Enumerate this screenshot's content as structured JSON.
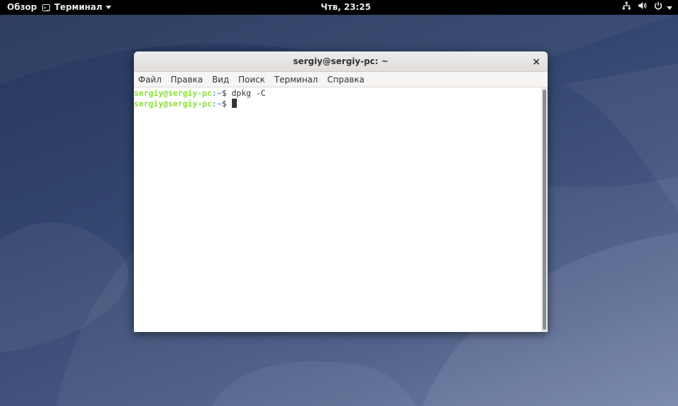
{
  "topbar": {
    "activities_label": "Обзор",
    "app_menu_label": "Терминал",
    "clock": "Чтв, 23:25",
    "icons": [
      "network-icon",
      "volume-icon",
      "power-icon",
      "chevron-down-icon"
    ]
  },
  "window": {
    "title": "sergiy@sergiy-pc: ~",
    "close_glyph": "×",
    "menu": [
      "Файл",
      "Правка",
      "Вид",
      "Поиск",
      "Терминал",
      "Справка"
    ]
  },
  "terminal": {
    "lines": [
      {
        "user_host": "sergiy@sergiy-pc",
        "path": ":~",
        "prompt": "$ ",
        "command": "dpkg -C"
      },
      {
        "user_host": "sergiy@sergiy-pc",
        "path": ":~",
        "prompt": "$ ",
        "command": ""
      }
    ]
  },
  "colors": {
    "prompt_user": "#8ae234",
    "prompt_path": "#729fcf",
    "topbar_bg": "#000000",
    "desktop_bg": "#2f3f66"
  }
}
